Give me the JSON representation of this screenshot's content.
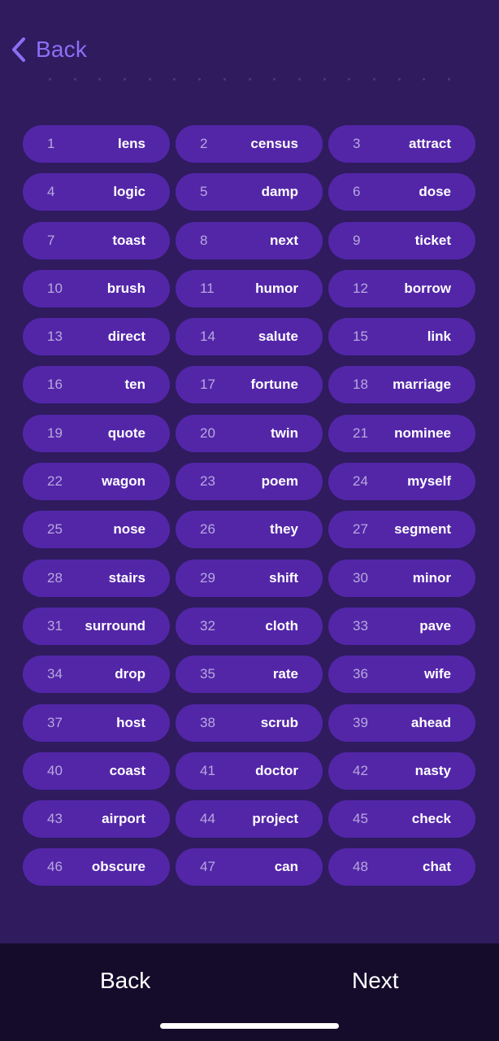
{
  "header": {
    "back_label": "Back"
  },
  "words": [
    {
      "n": "1",
      "w": "lens"
    },
    {
      "n": "2",
      "w": "census"
    },
    {
      "n": "3",
      "w": "attract"
    },
    {
      "n": "4",
      "w": "logic"
    },
    {
      "n": "5",
      "w": "damp"
    },
    {
      "n": "6",
      "w": "dose"
    },
    {
      "n": "7",
      "w": "toast"
    },
    {
      "n": "8",
      "w": "next"
    },
    {
      "n": "9",
      "w": "ticket"
    },
    {
      "n": "10",
      "w": "brush"
    },
    {
      "n": "11",
      "w": "humor"
    },
    {
      "n": "12",
      "w": "borrow"
    },
    {
      "n": "13",
      "w": "direct"
    },
    {
      "n": "14",
      "w": "salute"
    },
    {
      "n": "15",
      "w": "link"
    },
    {
      "n": "16",
      "w": "ten"
    },
    {
      "n": "17",
      "w": "fortune"
    },
    {
      "n": "18",
      "w": "marriage"
    },
    {
      "n": "19",
      "w": "quote"
    },
    {
      "n": "20",
      "w": "twin"
    },
    {
      "n": "21",
      "w": "nominee"
    },
    {
      "n": "22",
      "w": "wagon"
    },
    {
      "n": "23",
      "w": "poem"
    },
    {
      "n": "24",
      "w": "myself"
    },
    {
      "n": "25",
      "w": "nose"
    },
    {
      "n": "26",
      "w": "they"
    },
    {
      "n": "27",
      "w": "segment"
    },
    {
      "n": "28",
      "w": "stairs"
    },
    {
      "n": "29",
      "w": "shift"
    },
    {
      "n": "30",
      "w": "minor"
    },
    {
      "n": "31",
      "w": "surround"
    },
    {
      "n": "32",
      "w": "cloth"
    },
    {
      "n": "33",
      "w": "pave"
    },
    {
      "n": "34",
      "w": "drop"
    },
    {
      "n": "35",
      "w": "rate"
    },
    {
      "n": "36",
      "w": "wife"
    },
    {
      "n": "37",
      "w": "host"
    },
    {
      "n": "38",
      "w": "scrub"
    },
    {
      "n": "39",
      "w": "ahead"
    },
    {
      "n": "40",
      "w": "coast"
    },
    {
      "n": "41",
      "w": "doctor"
    },
    {
      "n": "42",
      "w": "nasty"
    },
    {
      "n": "43",
      "w": "airport"
    },
    {
      "n": "44",
      "w": "project"
    },
    {
      "n": "45",
      "w": "check"
    },
    {
      "n": "46",
      "w": "obscure"
    },
    {
      "n": "47",
      "w": "can"
    },
    {
      "n": "48",
      "w": "chat"
    }
  ],
  "footer": {
    "back_label": "Back",
    "next_label": "Next"
  },
  "colors": {
    "background": "#2f1b5e",
    "pill": "#5326a8",
    "accent": "#8c6ff5",
    "bottom_bar": "#150c2b"
  },
  "icons": {
    "back": "chevron-left-icon"
  }
}
